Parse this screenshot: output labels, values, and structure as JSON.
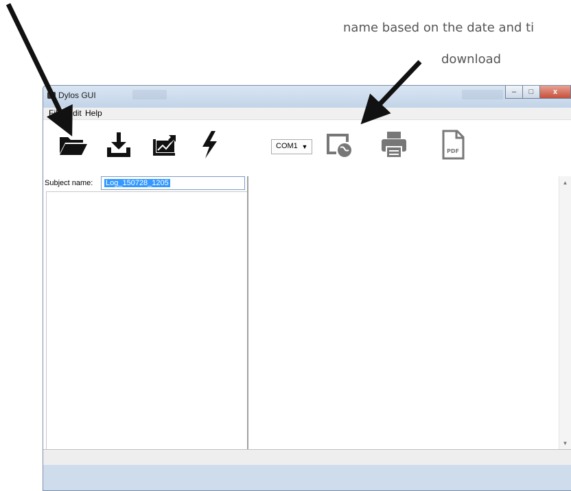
{
  "annotation": {
    "line1": "name based on the date and ti",
    "line2": "download"
  },
  "window": {
    "title": "Dylos GUI",
    "buttons": {
      "minimize": "–",
      "maximize": "□",
      "close": "x"
    }
  },
  "menu": {
    "items": [
      {
        "label": "File"
      },
      {
        "label": "Edit"
      },
      {
        "label": "Help"
      }
    ]
  },
  "toolbar": {
    "tools": [
      {
        "icon": "folder-open-icon"
      },
      {
        "icon": "download-icon"
      },
      {
        "icon": "chart-trend-icon"
      },
      {
        "icon": "lightning-icon"
      },
      {
        "icon": "web-upload-icon"
      },
      {
        "icon": "print-icon"
      },
      {
        "icon": "pdf-icon",
        "label": "PDF"
      }
    ],
    "port": {
      "value": "COM1"
    }
  },
  "subject": {
    "label": "Subject name:",
    "value": "Log_150728_1205"
  }
}
